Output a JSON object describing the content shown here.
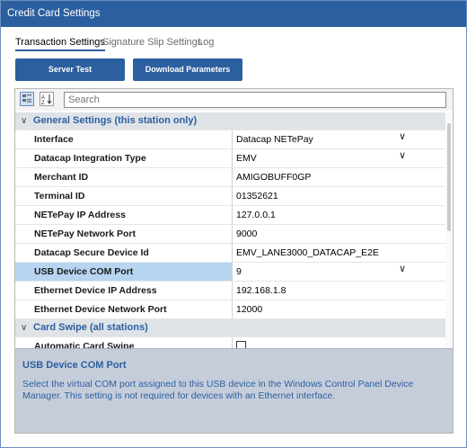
{
  "window": {
    "title": "Credit Card Settings"
  },
  "tabs": [
    {
      "label": "Transaction Settings",
      "active": true
    },
    {
      "label": "Signature Slip Settings",
      "active": false
    },
    {
      "label": "Log",
      "active": false
    }
  ],
  "buttons": {
    "server_test": "Server Test",
    "download_parameters": "Download Parameters"
  },
  "toolbar": {
    "categorized_icon": "categorized-view-icon",
    "alpha_icon": "alphabetical-sort-icon",
    "search_placeholder": "Search"
  },
  "categories": [
    {
      "label": "General Settings (this station only)",
      "rows": [
        {
          "name": "Interface",
          "value": "Datacap NETePay",
          "dropdown": true
        },
        {
          "name": "Datacap Integration Type",
          "value": "EMV",
          "dropdown": true
        },
        {
          "name": "Merchant ID",
          "value": "AMIGOBUFF0GP"
        },
        {
          "name": "Terminal ID",
          "value": "01352621"
        },
        {
          "name": "NETePay IP Address",
          "value": "127.0.0.1"
        },
        {
          "name": "NETePay Network Port",
          "value": "9000"
        },
        {
          "name": "Datacap Secure Device Id",
          "value": "EMV_LANE3000_DATACAP_E2E"
        },
        {
          "name": "USB Device COM Port",
          "value": "9",
          "dropdown": true,
          "selected": true
        },
        {
          "name": "Ethernet Device IP Address",
          "value": "192.168.1.8"
        },
        {
          "name": "Ethernet Device Network Port",
          "value": "12000"
        }
      ]
    },
    {
      "label": "Card Swipe (all stations)",
      "rows": [
        {
          "name": "Automatic Card Swipe",
          "checkbox": true,
          "checked": false
        }
      ]
    }
  ],
  "description": {
    "title": "USB Device COM Port",
    "text": "Select the virtual COM port assigned to this USB device in the Windows Control Panel Device Manager. This setting is not required for devices with an Ethernet interface."
  },
  "colors": {
    "accent": "#2c5f9f",
    "selected_row": "#b7d5f0",
    "description_bg": "#c5cddb"
  }
}
